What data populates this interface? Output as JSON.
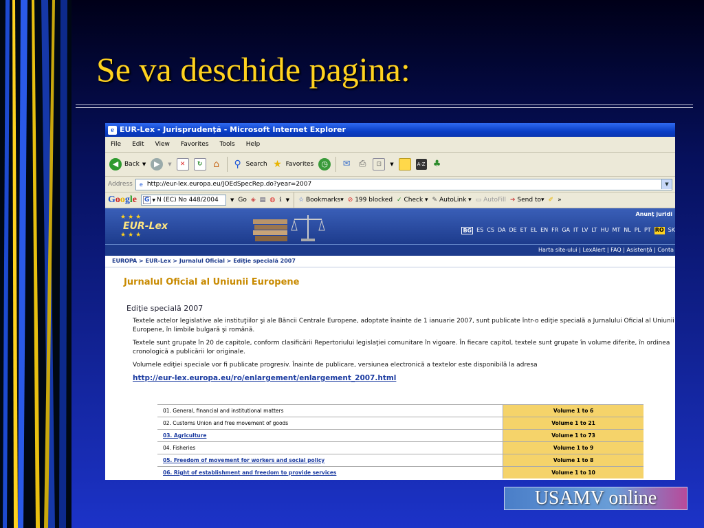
{
  "slide": {
    "title": "Se va deschide pagina:",
    "badge": "USAMV online"
  },
  "browser": {
    "window_title": "EUR-Lex - Jurisprudenţă - Microsoft Internet Explorer",
    "menu": [
      "File",
      "Edit",
      "View",
      "Favorites",
      "Tools",
      "Help"
    ],
    "toolbar": {
      "back": "Back",
      "search": "Search",
      "favorites": "Favorites"
    },
    "address_label": "Address",
    "address_value": "http://eur-lex.europa.eu/JOEdSpecRep.do?year=2007",
    "googlebar": {
      "logo": "Google",
      "query": "N (EC) No 448/2004",
      "go": "Go",
      "bookmarks": "Bookmarks",
      "blocked": "199 blocked",
      "check": "Check",
      "autolink": "AutoLink",
      "autofill": "AutoFill",
      "sendto": "Send to"
    }
  },
  "site": {
    "logo_text": "EUR-Lex",
    "annunt": "Anunţ juridi",
    "languages": [
      "BG",
      "ES",
      "CS",
      "DA",
      "DE",
      "ET",
      "EL",
      "EN",
      "FR",
      "GA",
      "IT",
      "LV",
      "LT",
      "HU",
      "MT",
      "NL",
      "PL",
      "PT",
      "RO",
      "SK"
    ],
    "top_links": "Harta site-ului | LexAlert | FAQ | Asistenţă | Conta",
    "breadcrumb": "EUROPA > EUR-Lex > Jurnalul Oficial > Ediţie specială 2007",
    "heading": "Jurnalul Oficial al Uniunii Europene",
    "subheading": "Ediţie specială 2007",
    "para1": "Textele actelor legislative ale instituţiilor şi ale Băncii Centrale Europene, adoptate înainte de 1 ianuarie 2007, sunt publicate într-o ediţie specială a Jurnalului Oficial al Uniunii Europene, în limbile bulgară şi română.",
    "para2": "Textele sunt grupate în 20 de capitole, conform clasificării Repertoriului legislaţiei comunitare în vigoare. În fiecare capitol, textele sunt grupate în volume diferite, în ordinea cronologică a publicării lor originale.",
    "para3": "Volumele ediţiei speciale vor fi publicate progresiv. Înainte de publicare, versiunea electronică a textelor este disponibilă la adresa",
    "url": "http://eur-lex.europa.eu/ro/enlargement/enlargement_2007.html",
    "chapters": [
      {
        "name": "01. General, financial and institutional matters",
        "volume": "Volume 1 to 6",
        "link": false
      },
      {
        "name": "02. Customs Union and free movement of goods",
        "volume": "Volume 1 to 21",
        "link": false
      },
      {
        "name": "03. Agriculture",
        "volume": "Volume 1 to 73",
        "link": true
      },
      {
        "name": "04. Fisheries",
        "volume": "Volume 1 to 9",
        "link": false
      },
      {
        "name": "05. Freedom of movement for workers and social policy",
        "volume": "Volume 1 to 8",
        "link": true
      },
      {
        "name": "06. Right of establishment and freedom to provide services",
        "volume": "Volume 1 to 10",
        "link": true
      }
    ]
  }
}
